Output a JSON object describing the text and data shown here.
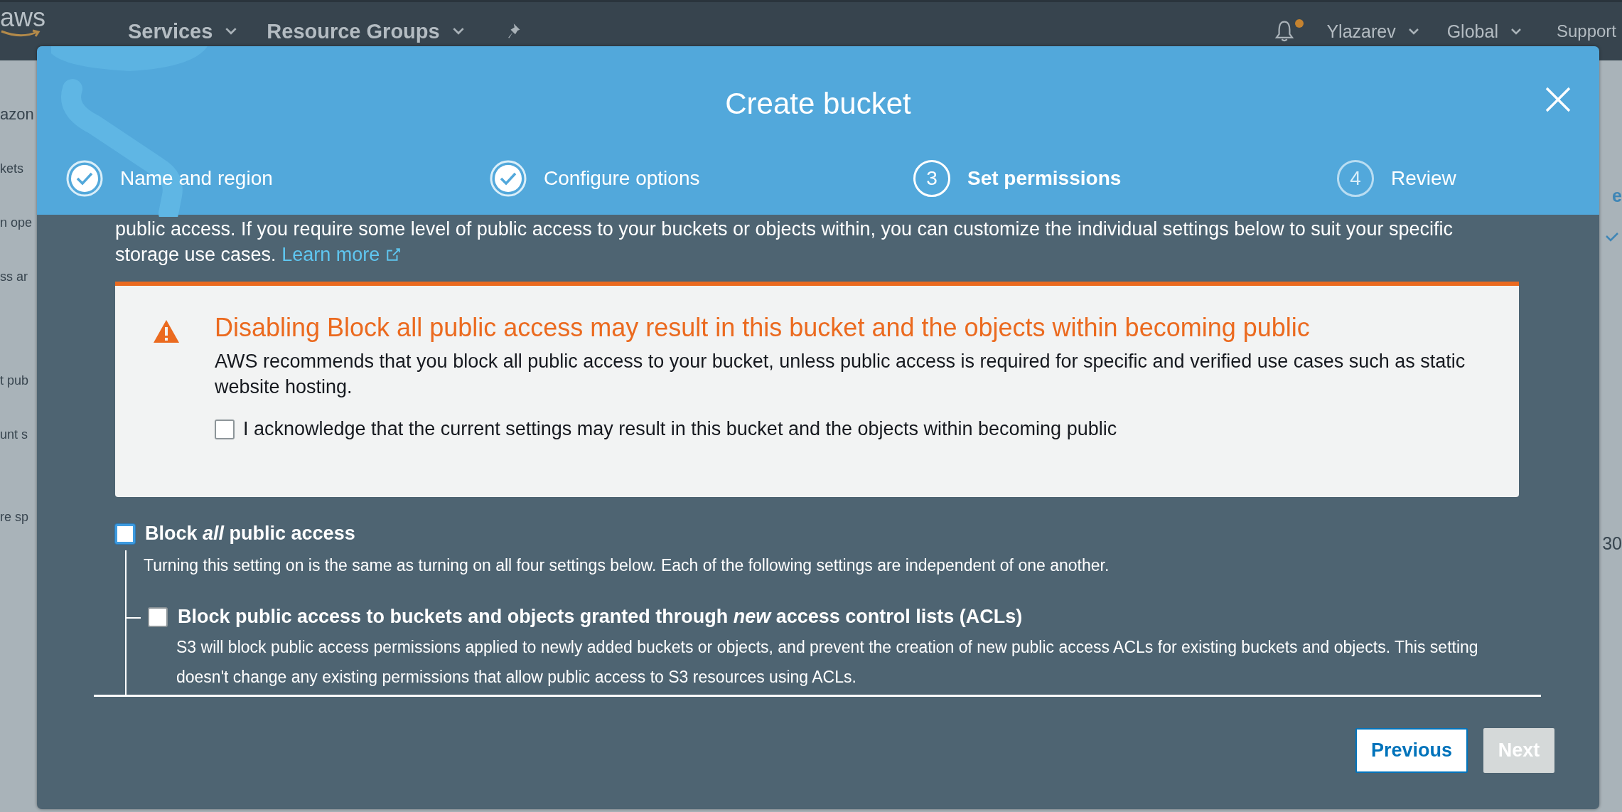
{
  "top_nav": {
    "logo": "aws",
    "menus": [
      {
        "label": "Services"
      },
      {
        "label": "Resource Groups"
      }
    ],
    "has_notification": true,
    "user": {
      "label": "Ylazarev"
    },
    "region": {
      "label": "Global"
    },
    "support": "Support"
  },
  "background_page": {
    "left_fragments": [
      {
        "text": "azon",
        "kind": "heading"
      },
      {
        "text": "kets",
        "kind": "line"
      },
      {
        "text": "n ope",
        "kind": "line"
      },
      {
        "text": "ss ar",
        "kind": "line"
      },
      {
        "text": "t pub",
        "kind": "block"
      },
      {
        "text": "unt s",
        "kind": "line"
      },
      {
        "text": "re sp",
        "kind": "block"
      }
    ],
    "right_fragments": [
      {
        "text": "e",
        "kind": "link"
      },
      {
        "text": "30",
        "kind": "line"
      }
    ]
  },
  "modal": {
    "title": "Create bucket",
    "steps": [
      {
        "label": "Name and region",
        "completed": true,
        "selected": false
      },
      {
        "label": "Configure options",
        "completed": true,
        "selected": false
      },
      {
        "label": "Set permissions",
        "number": "3",
        "completed": false,
        "selected": true
      },
      {
        "label": "Review",
        "number": "4",
        "completed": false,
        "selected": false
      }
    ],
    "intro": {
      "text": "public access. If you require some level of public access to your buckets or objects within, you can customize the individual settings below to suit your specific storage use cases.",
      "link": "Learn more"
    },
    "warning": {
      "title": "Disabling Block all public access may result in this bucket and the objects within becoming public",
      "text": "AWS recommends that you block all public access to your bucket, unless public access is required for specific and verified use cases such as static website hosting.",
      "acknowledge": {
        "label": "I acknowledge that the current settings may result in this bucket and the objects within becoming public",
        "checked": false
      }
    },
    "block_all": {
      "label": "Block *all* public access",
      "description": "Turning this setting on is the same as turning on all four settings below. Each of the following settings are independent of one another.",
      "checked": false,
      "children": [
        {
          "label": "Block public access to buckets and objects granted through *new* access control lists (ACLs)",
          "description": "S3 will block public access permissions applied to newly added buckets or objects, and prevent the creation of new public access ACLs for existing buckets and objects. This setting doesn't change any existing permissions that allow public access to S3 resources using ACLs.",
          "checked": false
        }
      ]
    },
    "buttons": [
      {
        "label": "Previous",
        "kind": "secondary",
        "disabled": false
      },
      {
        "label": "Next",
        "kind": "primary",
        "disabled": true
      }
    ]
  }
}
